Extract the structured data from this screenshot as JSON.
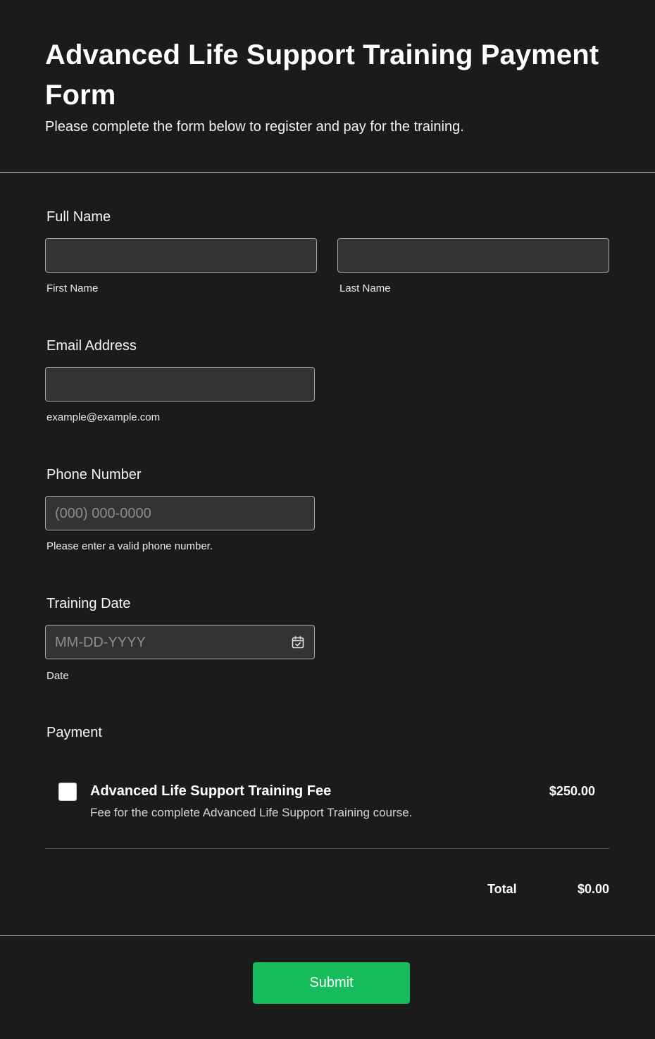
{
  "header": {
    "title": "Advanced Life Support Training Payment Form",
    "subtitle": "Please complete the form below to register and pay for the training."
  },
  "full_name": {
    "label": "Full Name",
    "first_sublabel": "First Name",
    "last_sublabel": "Last Name"
  },
  "email": {
    "label": "Email Address",
    "sublabel": "example@example.com"
  },
  "phone": {
    "label": "Phone Number",
    "placeholder": "(000) 000-0000",
    "sublabel": "Please enter a valid phone number."
  },
  "training_date": {
    "label": "Training Date",
    "placeholder": "MM-DD-YYYY",
    "sublabel": "Date",
    "icon": "calendar-check-icon"
  },
  "payment": {
    "label": "Payment",
    "product": {
      "name": "Advanced Life Support Training Fee",
      "description": "Fee for the complete Advanced Life Support Training course.",
      "price": "$250.00",
      "checked": false
    },
    "total_label": "Total",
    "total_value": "$0.00"
  },
  "submit": {
    "label": "Submit",
    "color": "#18bd5b"
  }
}
